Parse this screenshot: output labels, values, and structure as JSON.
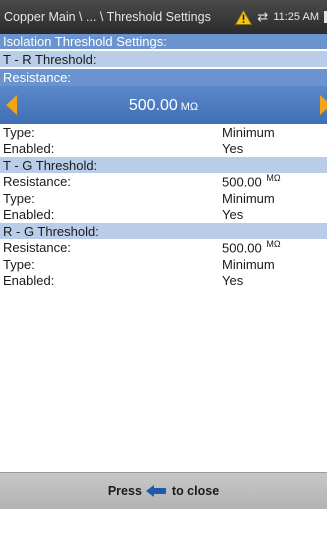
{
  "statusbar": {
    "path": "Copper Main \\ ... \\ Threshold Settings",
    "time": "11:25 AM",
    "warning_icon": "warning-triangle-icon",
    "network_icon": "network-arrows-icon",
    "battery_icon": "battery-icon"
  },
  "section_title": "Isolation Threshold Settings:",
  "tr": {
    "header": "T - R Threshold:",
    "resistance_label": "Resistance:",
    "resistance_value": "500.00",
    "resistance_unit": "MΩ",
    "type_label": "Type:",
    "type_value": "Minimum",
    "enabled_label": "Enabled:",
    "enabled_value": "Yes"
  },
  "tg": {
    "header": "T - G Threshold:",
    "resistance_label": "Resistance:",
    "resistance_value": "500.00",
    "resistance_unit": "MΩ",
    "type_label": "Type:",
    "type_value": "Minimum",
    "enabled_label": "Enabled:",
    "enabled_value": "Yes"
  },
  "rg": {
    "header": "R - G Threshold:",
    "resistance_label": "Resistance:",
    "resistance_value": "500.00",
    "resistance_unit": "MΩ",
    "type_label": "Type:",
    "type_value": "Minimum",
    "enabled_label": "Enabled:",
    "enabled_value": "Yes"
  },
  "footer": {
    "press_label": "Press",
    "close_label": "to close",
    "back_icon": "back-arrow-icon"
  },
  "colors": {
    "header_dark": "#6b93cf",
    "header_light": "#b9cce8",
    "arrow_accent": "#f4a418",
    "warning": "#f5c518"
  }
}
